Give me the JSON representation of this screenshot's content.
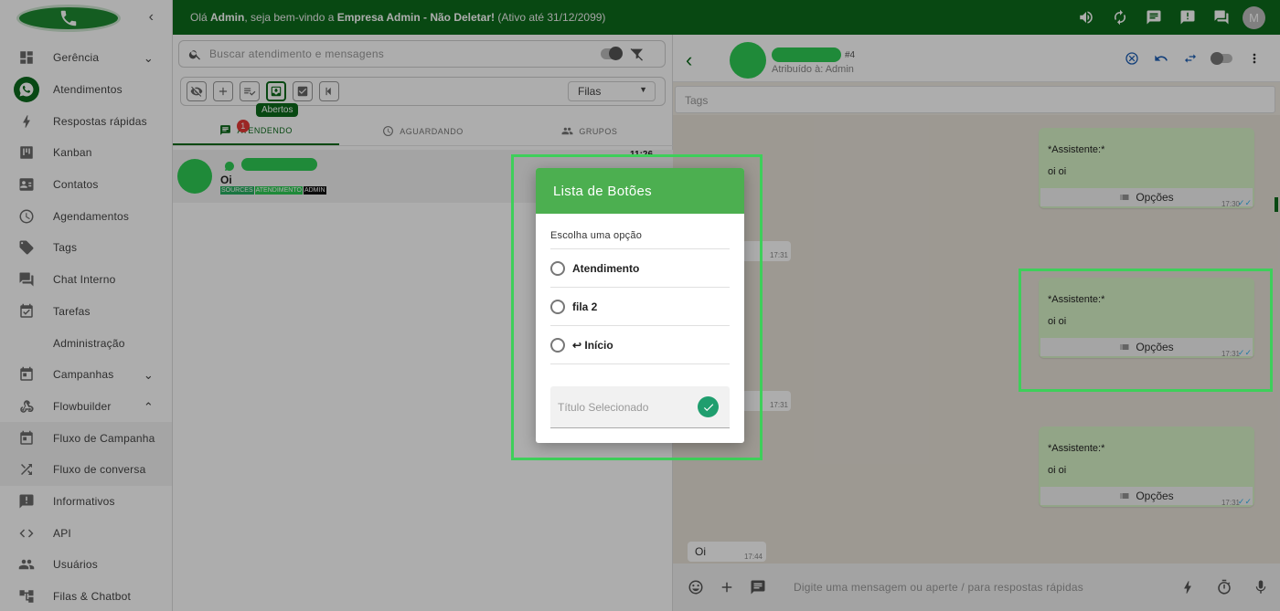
{
  "header": {
    "greeting_prefix": "Olá ",
    "user": "Admin",
    "greeting_mid": ", seja bem-vindo a ",
    "company": "Empresa Admin - Não Deletar!",
    "greeting_suffix": " (Ativo até 31/12/2099)",
    "avatar_letter": "M"
  },
  "sidebar": {
    "items": [
      {
        "label": "Gerência",
        "icon": "dashboard-icon"
      },
      {
        "label": "Atendimentos",
        "icon": "whatsapp-icon"
      },
      {
        "label": "Respostas rápidas",
        "icon": "bolt-icon"
      },
      {
        "label": "Kanban",
        "icon": "kanban-icon"
      },
      {
        "label": "Contatos",
        "icon": "contacts-icon"
      },
      {
        "label": "Agendamentos",
        "icon": "clock-icon"
      },
      {
        "label": "Tags",
        "icon": "tag-icon"
      },
      {
        "label": "Chat Interno",
        "icon": "forum-icon"
      },
      {
        "label": "Tarefas",
        "icon": "calendar-check-icon"
      },
      {
        "label": "Administração",
        "icon": ""
      },
      {
        "label": "Campanhas",
        "icon": "event-icon"
      },
      {
        "label": "Flowbuilder",
        "icon": "webhook-icon"
      },
      {
        "label": "Fluxo de Campanha",
        "icon": "event-icon"
      },
      {
        "label": "Fluxo de conversa",
        "icon": "shuffle-icon"
      },
      {
        "label": "Informativos",
        "icon": "announcement-icon"
      },
      {
        "label": "API",
        "icon": "code-icon"
      },
      {
        "label": "Usuários",
        "icon": "people-icon"
      },
      {
        "label": "Filas & Chatbot",
        "icon": "account-tree-icon"
      }
    ]
  },
  "tickets": {
    "search_placeholder": "Buscar atendimento e mensagens",
    "tooltip": "Abertos",
    "queues_label": "Filas",
    "tabs": [
      {
        "label": "ATENDENDO",
        "badge": "1"
      },
      {
        "label": "AGUARDANDO"
      },
      {
        "label": "GRUPOS"
      }
    ],
    "item": {
      "message": "Oi",
      "time": "11:26",
      "tags": [
        {
          "label": "SOURCES",
          "color": "#27ae60"
        },
        {
          "label": "ATENDIMENTO",
          "color": "#2ecc55"
        },
        {
          "label": "ADMIN",
          "color": "#111111"
        }
      ]
    }
  },
  "chat": {
    "ticket_number": "#4",
    "assigned": "Atribuído à: Admin",
    "tags_placeholder": "Tags",
    "out_messages": [
      {
        "line1": "*Assistente:*",
        "line2": "oi oi",
        "button": "Opções",
        "time": "17:30"
      },
      {
        "line1": "*Assistente:*",
        "line2": "oi oi",
        "button": "Opções",
        "time": "17:31"
      },
      {
        "line1": "*Assistente:*",
        "line2": "oi oi",
        "button": "Opções",
        "time": "17:31"
      }
    ],
    "in_times": [
      "17:31",
      "17:31"
    ],
    "last_in": {
      "text": "Oi",
      "time": "17:44"
    },
    "composer_placeholder": "Digite uma mensagem ou aperte / para respostas rápidas"
  },
  "modal": {
    "title": "Lista de Botões",
    "subtitle": "Escolha uma opção",
    "options": [
      "Atendimento",
      "fila 2",
      "↩ Início"
    ],
    "field_placeholder": "Título Selecionado"
  },
  "colors": {
    "primary": "#0c6b1b",
    "accent": "#4caf50",
    "highlight": "#3ecf5a"
  }
}
